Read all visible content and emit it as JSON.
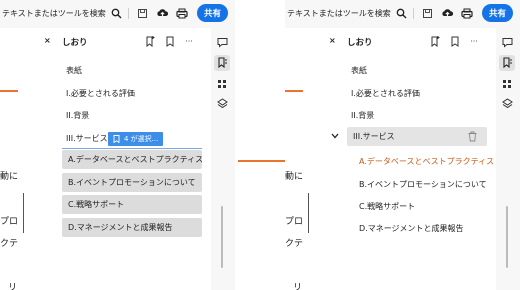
{
  "toolbar": {
    "search_placeholder": "テキストまたはツールを検索",
    "share_label": "共有"
  },
  "bookmarks": {
    "title": "しおり",
    "close_glyph": "×",
    "more_glyph": "···"
  },
  "left": {
    "items": [
      "表紙",
      "I.必要とされる評価",
      "II.背景",
      "III.サービス"
    ],
    "drag_tooltip": "4 が選択...",
    "children": [
      "A.データベースとベストプラクティス",
      "B.イベントプロモーションについて",
      "C.戦略サポート",
      "D.マネージメントと成果報告"
    ],
    "doc_text": [
      "動に",
      "プロ",
      "クテ",
      "リ"
    ]
  },
  "right": {
    "items": [
      "表紙",
      "I.必要とされる評価",
      "II.背景",
      "III.サービス"
    ],
    "children": [
      "A.データベースとベストプラクティス",
      "B.イベントプロモーションについて",
      "C.戦略サポート",
      "D.マネージメントと成果報告"
    ],
    "doc_text": [
      "動に",
      "プロ",
      "クテ",
      "リ"
    ]
  },
  "colors": {
    "accent_blue": "#1473e6",
    "arrow_orange": "#e8752b",
    "selection_gray": "#dcdcdc"
  }
}
